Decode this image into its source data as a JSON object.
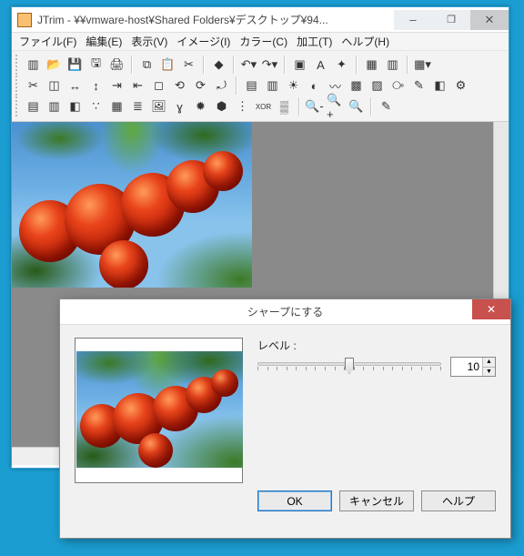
{
  "window": {
    "title": "JTrim - ¥¥vmware-host¥Shared Folders¥デスクトップ¥94...",
    "app_name": "JTrim"
  },
  "menu": {
    "items": [
      "ファイル(F)",
      "編集(E)",
      "表示(V)",
      "イメージ(I)",
      "カラー(C)",
      "加工(T)",
      "ヘルプ(H)"
    ]
  },
  "toolbar": {
    "row1": [
      "new",
      "open",
      "save",
      "saveas",
      "print",
      "sep",
      "copy",
      "paste",
      "cut",
      "sep",
      "info",
      "sep",
      "undo-dd",
      "redo-dd",
      "sep",
      "fit",
      "font",
      "stamp",
      "sep",
      "grid",
      "film",
      "sep",
      "palette-dd"
    ],
    "row2": [
      "crop",
      "deselect",
      "flip-h",
      "flip-v",
      "resize-in",
      "resize-out",
      "handle-box",
      "rot-l90",
      "rot-r90",
      "rot-free",
      "sep",
      "fill",
      "sharpen",
      "bright",
      "contrast",
      "wave",
      "tile",
      "screen",
      "levels",
      "pen",
      "eraser",
      "gear"
    ],
    "row3": [
      "grad1",
      "grad2",
      "invert",
      "noise",
      "rainbow",
      "levels2",
      "pict",
      "gamma",
      "hue",
      "rgb",
      "channel",
      "xor",
      "half",
      "sep",
      "zoom-out",
      "zoom-in",
      "zoom-fit",
      "sep",
      "picker"
    ],
    "icon_labels": {
      "new": "new-icon",
      "open": "open-icon",
      "save": "save-icon",
      "saveas": "saveas-icon",
      "print": "print-icon",
      "copy": "copy-icon",
      "paste": "paste-icon",
      "cut": "cut-icon",
      "info": "info-icon",
      "undo-dd": "undo-icon",
      "redo-dd": "redo-icon",
      "fit": "fit-icon",
      "font": "font-icon",
      "stamp": "stamp-icon",
      "grid": "grid-icon",
      "film": "film-icon",
      "palette-dd": "palette-icon",
      "crop": "crop-icon",
      "deselect": "deselect-icon",
      "flip-h": "flip-h-icon",
      "flip-v": "flip-v-icon",
      "resize-in": "resize-in-icon",
      "resize-out": "resize-out-icon",
      "handle-box": "handle-icon",
      "rot-l90": "rotate-left-icon",
      "rot-r90": "rotate-right-icon",
      "rot-free": "rotate-free-icon",
      "fill": "fill-icon",
      "sharpen": "sharpen-icon",
      "bright": "brightness-icon",
      "contrast": "contrast-icon",
      "wave": "wave-icon",
      "tile": "tile-icon",
      "screen": "screen-icon",
      "levels": "levels-icon",
      "pen": "pen-icon",
      "eraser": "eraser-icon",
      "gear": "settings-icon",
      "grad1": "gradient-icon",
      "grad2": "gradient2-icon",
      "invert": "invert-icon",
      "noise": "noise-icon",
      "rainbow": "rainbow-icon",
      "levels2": "levels2-icon",
      "pict": "picture-icon",
      "gamma": "gamma-icon",
      "hue": "hue-icon",
      "rgb": "rgb-icon",
      "channel": "channel-icon",
      "xor": "xor-icon",
      "half": "halftone-icon",
      "zoom-out": "zoom-out-icon",
      "zoom-in": "zoom-in-icon",
      "zoom-fit": "zoom-fit-icon",
      "picker": "eyedropper-icon"
    }
  },
  "dialog": {
    "title": "シャープにする",
    "level_label": "レベル :",
    "level_value": "10",
    "slider_min": 1,
    "slider_max": 20,
    "slider_pos_pct": 50,
    "ok_label": "OK",
    "cancel_label": "キャンセル",
    "help_label": "ヘルプ"
  }
}
